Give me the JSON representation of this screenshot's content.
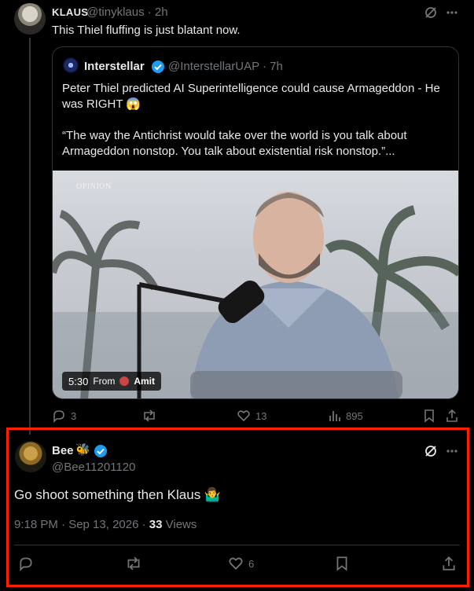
{
  "top_tweet": {
    "display_name": "KLAUS",
    "handle": "@tinyklaus",
    "time": "· 2h",
    "text": "This Thiel fluffing is just blatant now."
  },
  "quoted_tweet": {
    "display_name": "Interstellar",
    "handle": "@InterstellarUAP · 7h",
    "text_line1": "Peter Thiel predicted AI Superintelligence could cause Armageddon - He was RIGHT 😱",
    "text_line2": "“The way the Antichrist would take over the world is you talk about Armageddon nonstop. You talk about existential risk nonstop.”...",
    "video": {
      "watermark": "OPINION",
      "duration": "5:30",
      "from_label": "From",
      "from_user": "Amit"
    }
  },
  "top_actions": {
    "replies": "3",
    "likes": "13",
    "views": "895"
  },
  "reply_tweet": {
    "display_name": "Bee",
    "emoji": "🐝",
    "handle": "@Bee11201120",
    "text": "Go shoot something then Klaus 🤷‍♂️",
    "timestamp": "9:18 PM · Sep 13, 2026 · ",
    "views_count": "33",
    "views_label": " Views",
    "likes": "6"
  },
  "colors": {
    "background": "#000000",
    "text": "#e7e9ea",
    "muted": "#71767b",
    "verified": "#1d9bf0",
    "highlight_box": "#ff1f00",
    "border": "#2f3336"
  },
  "icons": [
    "grok-icon",
    "more-icon",
    "verified-icon",
    "reply-icon",
    "retweet-icon",
    "like-icon",
    "views-icon",
    "bookmark-icon",
    "share-icon"
  ]
}
